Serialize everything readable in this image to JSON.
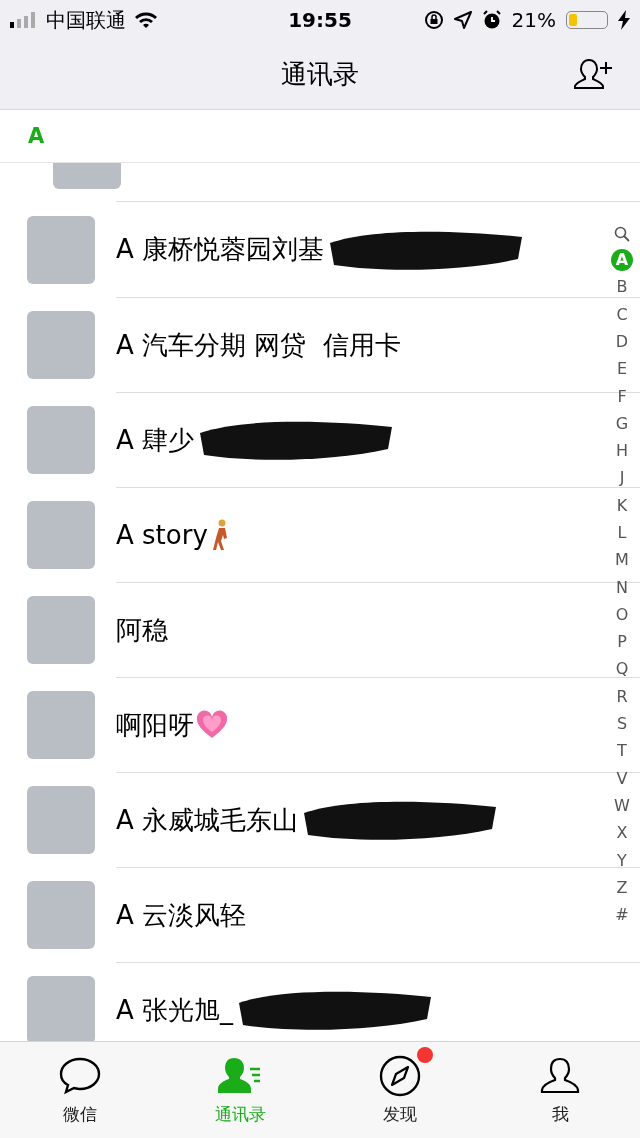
{
  "status_bar": {
    "carrier": "中国联通",
    "time": "19:55",
    "battery": "21%"
  },
  "nav": {
    "title": "通讯录"
  },
  "section": {
    "letter": "A"
  },
  "contacts": [
    {
      "name": "A 康桥悦蓉园刘基",
      "kind": "redacted"
    },
    {
      "name": "A 汽车分期 网贷  信用卡",
      "kind": "plain"
    },
    {
      "name": "A 肆少",
      "kind": "redacted"
    },
    {
      "name": "A story",
      "kind": "walker"
    },
    {
      "name": "阿稳",
      "kind": "plain"
    },
    {
      "name": "啊阳呀",
      "kind": "heart"
    },
    {
      "name": "A 永威城毛东山",
      "kind": "redacted"
    },
    {
      "name": "A 云淡风轻",
      "kind": "plain"
    },
    {
      "name": "A 张光旭_",
      "kind": "redacted"
    }
  ],
  "index_bar": [
    {
      "letter": "A",
      "selected": true
    },
    {
      "letter": "B",
      "selected": false
    },
    {
      "letter": "C",
      "selected": false
    },
    {
      "letter": "D",
      "selected": false
    },
    {
      "letter": "E",
      "selected": false
    },
    {
      "letter": "F",
      "selected": false
    },
    {
      "letter": "G",
      "selected": false
    },
    {
      "letter": "H",
      "selected": false
    },
    {
      "letter": "J",
      "selected": false
    },
    {
      "letter": "K",
      "selected": false
    },
    {
      "letter": "L",
      "selected": false
    },
    {
      "letter": "M",
      "selected": false
    },
    {
      "letter": "N",
      "selected": false
    },
    {
      "letter": "O",
      "selected": false
    },
    {
      "letter": "P",
      "selected": false
    },
    {
      "letter": "Q",
      "selected": false
    },
    {
      "letter": "R",
      "selected": false
    },
    {
      "letter": "S",
      "selected": false
    },
    {
      "letter": "T",
      "selected": false
    },
    {
      "letter": "V",
      "selected": false
    },
    {
      "letter": "W",
      "selected": false
    },
    {
      "letter": "X",
      "selected": false
    },
    {
      "letter": "Y",
      "selected": false
    },
    {
      "letter": "Z",
      "selected": false
    },
    {
      "letter": "#",
      "selected": false
    }
  ],
  "tab_bar": [
    {
      "label": "微信",
      "kind": "chat",
      "selected": false,
      "badge": false
    },
    {
      "label": "通讯录",
      "kind": "contacts",
      "selected": true,
      "badge": false
    },
    {
      "label": "发现",
      "kind": "discover",
      "selected": false,
      "badge": true
    },
    {
      "label": "我",
      "kind": "me",
      "selected": false,
      "badge": false
    }
  ]
}
